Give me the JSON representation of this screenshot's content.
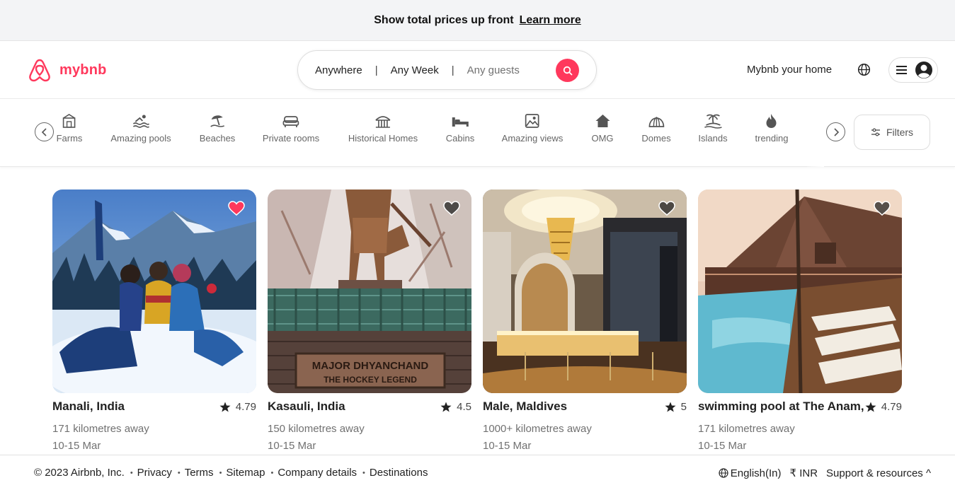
{
  "banner": {
    "text": "Show total prices up front",
    "link": "Learn more"
  },
  "header": {
    "brand": "mybnb",
    "search": {
      "where": "Anywhere",
      "when": "Any Week",
      "guests": "Any guests",
      "sep": "|"
    },
    "host_link": "Mybnb your home"
  },
  "categories": {
    "items": [
      {
        "label": "Farms",
        "icon": "farm-icon"
      },
      {
        "label": "Amazing pools",
        "icon": "pool-icon"
      },
      {
        "label": "Beaches",
        "icon": "beach-icon"
      },
      {
        "label": "Private rooms",
        "icon": "bed-icon"
      },
      {
        "label": "Historical Homes",
        "icon": "historic-home-icon"
      },
      {
        "label": "Cabins",
        "icon": "cabin-icon"
      },
      {
        "label": "Amazing views",
        "icon": "view-icon"
      },
      {
        "label": "OMG",
        "icon": "omg-icon"
      },
      {
        "label": "Domes",
        "icon": "dome-icon"
      },
      {
        "label": "Islands",
        "icon": "island-icon"
      },
      {
        "label": "trending",
        "icon": "fire-icon"
      }
    ],
    "filters": "Filters"
  },
  "listings": [
    {
      "title": "Manali, India",
      "rating": "4.79",
      "distance": "171 kilometres away",
      "dates": "10-15 Mar",
      "favorited": true
    },
    {
      "title": "Kasauli, India",
      "rating": "4.5",
      "distance": "150 kilometres away",
      "dates": "10-15 Mar",
      "favorited": false
    },
    {
      "title": "Male, Maldives",
      "rating": "5",
      "distance": "1000+ kilometres away",
      "dates": "10-15 Mar",
      "favorited": false
    },
    {
      "title": "swimming pool at The Anam,",
      "rating": "4.79",
      "distance": "171 kilometres away",
      "dates": "10-15 Mar",
      "favorited": false
    }
  ],
  "footer": {
    "copyright": "© 2023 Airbnb, Inc.",
    "links": [
      "Privacy",
      "Terms",
      "Sitemap",
      "Company details",
      "Destinations"
    ],
    "language": "English(In)",
    "currency": "₹ INR",
    "support": "Support & resources ^"
  },
  "colors": {
    "brand": "#ff385c",
    "favorite": "#ff385c"
  }
}
